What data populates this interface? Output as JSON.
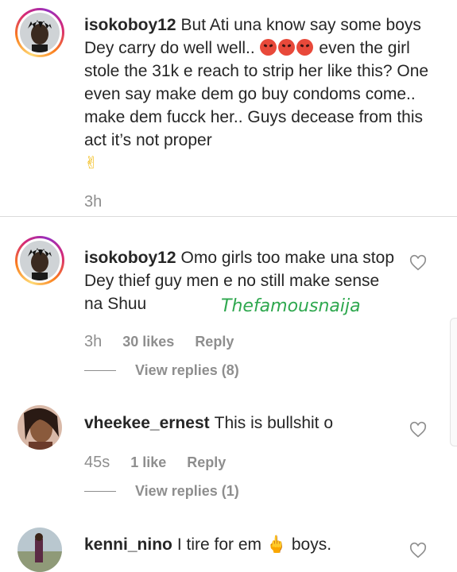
{
  "comments": [
    {
      "username": "isokoboy12",
      "text_a": "But Ati una know say some boys Dey carry do well well.. ",
      "text_b": " even the girl stole the 31k e reach to strip her like this? One even say make dem go buy condoms come.. make dem fucck her.. Guys decease from this act it’s not proper",
      "emoji_peace": "✌",
      "time": "3h"
    },
    {
      "username": "isokoboy12",
      "text": "Omo girls too make una stop Dey thief guy men e no still make sense na Shuu",
      "time": "3h",
      "likes": "30 likes",
      "reply": "Reply",
      "view_replies": "View replies (8)"
    },
    {
      "username": "vheekee_ernest",
      "text": "This is bullshit o",
      "time": "45s",
      "likes": "1 like",
      "reply": "Reply",
      "view_replies": "View replies (1)"
    },
    {
      "username": "kenni_nino",
      "text_a": "I tire for em ",
      "emoji_finger": "🖕",
      "text_b": " boys."
    }
  ],
  "watermark": "Thefamousnaija",
  "colors": {
    "accent_green": "#2fa84f",
    "muted": "#8e8e8e"
  }
}
